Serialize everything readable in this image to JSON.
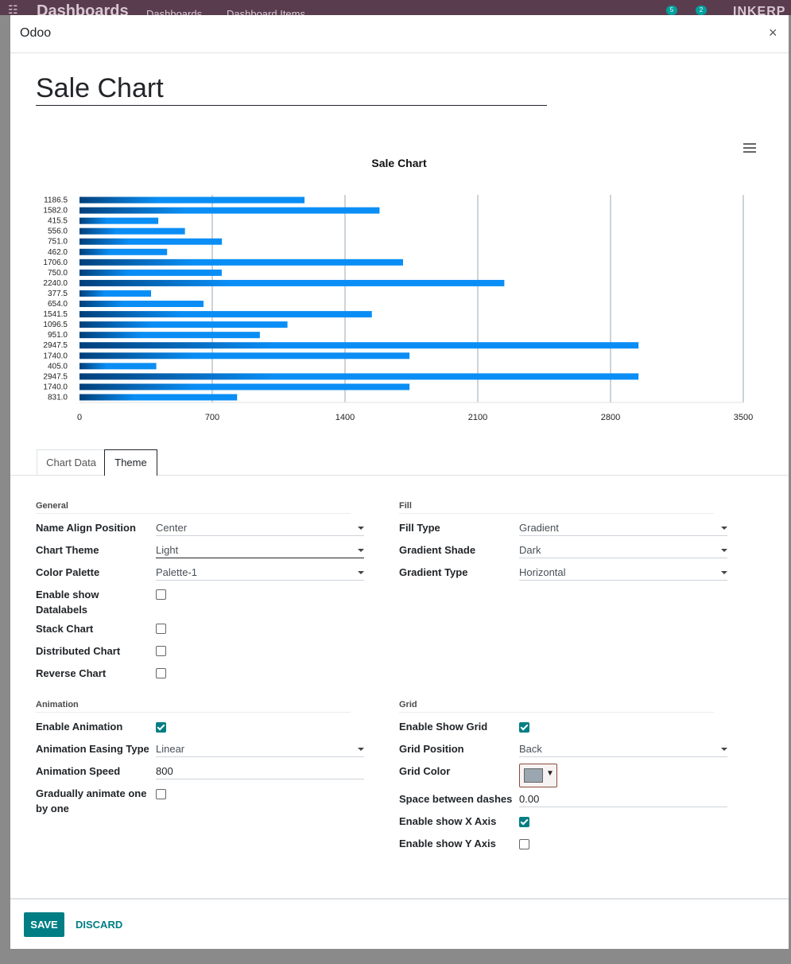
{
  "app": {
    "brand": "Dashboards",
    "menu": [
      "Dashboards",
      "Dashboard Items"
    ],
    "badge_messages": "5",
    "badge_activities": "2",
    "logo_text": "INKERP"
  },
  "dialog": {
    "title": "Odoo",
    "close_label": "×",
    "item_name": "Sale Chart"
  },
  "chart_data": {
    "type": "bar",
    "orientation": "horizontal",
    "title": "Sale Chart",
    "categories": [
      "1186.5",
      "1582.0",
      "415.5",
      "556.0",
      "751.0",
      "462.0",
      "1706.0",
      "750.0",
      "2240.0",
      "377.5",
      "654.0",
      "1541.5",
      "1096.5",
      "951.0",
      "2947.5",
      "1740.0",
      "405.0",
      "2947.5",
      "1740.0",
      "831.0"
    ],
    "values": [
      1186.5,
      1582.0,
      415.5,
      556.0,
      751.0,
      462.0,
      1706.0,
      750.0,
      2240.0,
      377.5,
      654.0,
      1541.5,
      1096.5,
      951.0,
      2947.5,
      1740.0,
      405.0,
      2947.5,
      1740.0,
      831.0
    ],
    "xlim": [
      0,
      3500
    ],
    "xticks": [
      "0",
      "700",
      "1400",
      "2100",
      "2800",
      "3500"
    ],
    "grid": true,
    "fill": "gradient",
    "colors": {
      "dark": "#00407a",
      "light": "#0a8ef5",
      "grid": "#9aa7b0"
    }
  },
  "tabs": [
    "Chart Data",
    "Theme"
  ],
  "active_tab": "Theme",
  "general": {
    "title": "General",
    "name_align_label": "Name Align Position",
    "name_align_value": "Center",
    "chart_theme_label": "Chart Theme",
    "chart_theme_value": "Light",
    "color_palette_label": "Color Palette",
    "color_palette_value": "Palette-1",
    "datalabels_label": "Enable show Datalabels",
    "datalabels": false,
    "stack_label": "Stack Chart",
    "stack": false,
    "distributed_label": "Distributed Chart",
    "distributed": false,
    "reverse_label": "Reverse Chart",
    "reverse": false
  },
  "fill": {
    "title": "Fill",
    "fill_type_label": "Fill Type",
    "fill_type_value": "Gradient",
    "gradient_shade_label": "Gradient Shade",
    "gradient_shade_value": "Dark",
    "gradient_type_label": "Gradient Type",
    "gradient_type_value": "Horizontal"
  },
  "animation": {
    "title": "Animation",
    "enable_label": "Enable Animation",
    "enable": true,
    "easing_label": "Animation Easing Type",
    "easing_value": "Linear",
    "speed_label": "Animation Speed",
    "speed_value": "800",
    "gradual_label": "Gradually animate one by one",
    "gradual": false
  },
  "grid": {
    "title": "Grid",
    "show_grid_label": "Enable Show Grid",
    "show_grid": true,
    "position_label": "Grid Position",
    "position_value": "Back",
    "color_label": "Grid Color",
    "color_value": "#9aa7b0",
    "dashes_label": "Space between dashes",
    "dashes_value": "0.00",
    "x_axis_label": "Enable show X Axis",
    "x_axis": true,
    "y_axis_label": "Enable show Y Axis",
    "y_axis": false
  },
  "footer": {
    "save_label": "SAVE",
    "discard_label": "DISCARD"
  }
}
